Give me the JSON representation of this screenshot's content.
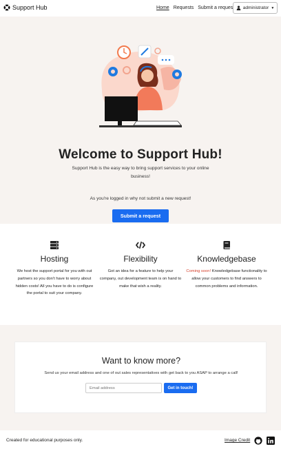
{
  "nav": {
    "brand": "Support Hub",
    "links": [
      "Home",
      "Requests",
      "Submit a request"
    ],
    "user": "administrator"
  },
  "hero": {
    "title": "Welcome to Support Hub!",
    "subtitle": "Support Hub is the easy way to bring support services to your online business!",
    "login_note": "As you're logged in why not submit a new request!",
    "button": "Submit a request"
  },
  "features": [
    {
      "icon": "server-icon",
      "title": "Hosting",
      "text": "We host the support portal for you with out partners so you don't have to worry about hidden costs! All you have to do is configure the portal to suit your company."
    },
    {
      "icon": "code-icon",
      "title": "Flexibility",
      "text": "Got an idea for a feature to help your company, out development team is on hand to make that wish a reality."
    },
    {
      "icon": "book-icon",
      "title": "Knowledgebase",
      "soon": "Coming soon!",
      "text": " Knowledgebase functionality to allow your customers to find answers to common problems and information."
    }
  ],
  "contact": {
    "title": "Want to know more?",
    "subtitle": "Send us your email address and one of out sales representatives with get back to you ASAP to arrange a call!",
    "placeholder": "Email address",
    "button": "Get in touch!"
  },
  "footer": {
    "text": "Created for educational purposes only.",
    "credit": "Image Credit"
  },
  "colors": {
    "accent": "#1a6cf0",
    "hero_bg": "#f7f3f0",
    "soon": "#d43f2a",
    "illustration_pink": "#f7b7a3",
    "illustration_blue": "#1f7ae0"
  }
}
